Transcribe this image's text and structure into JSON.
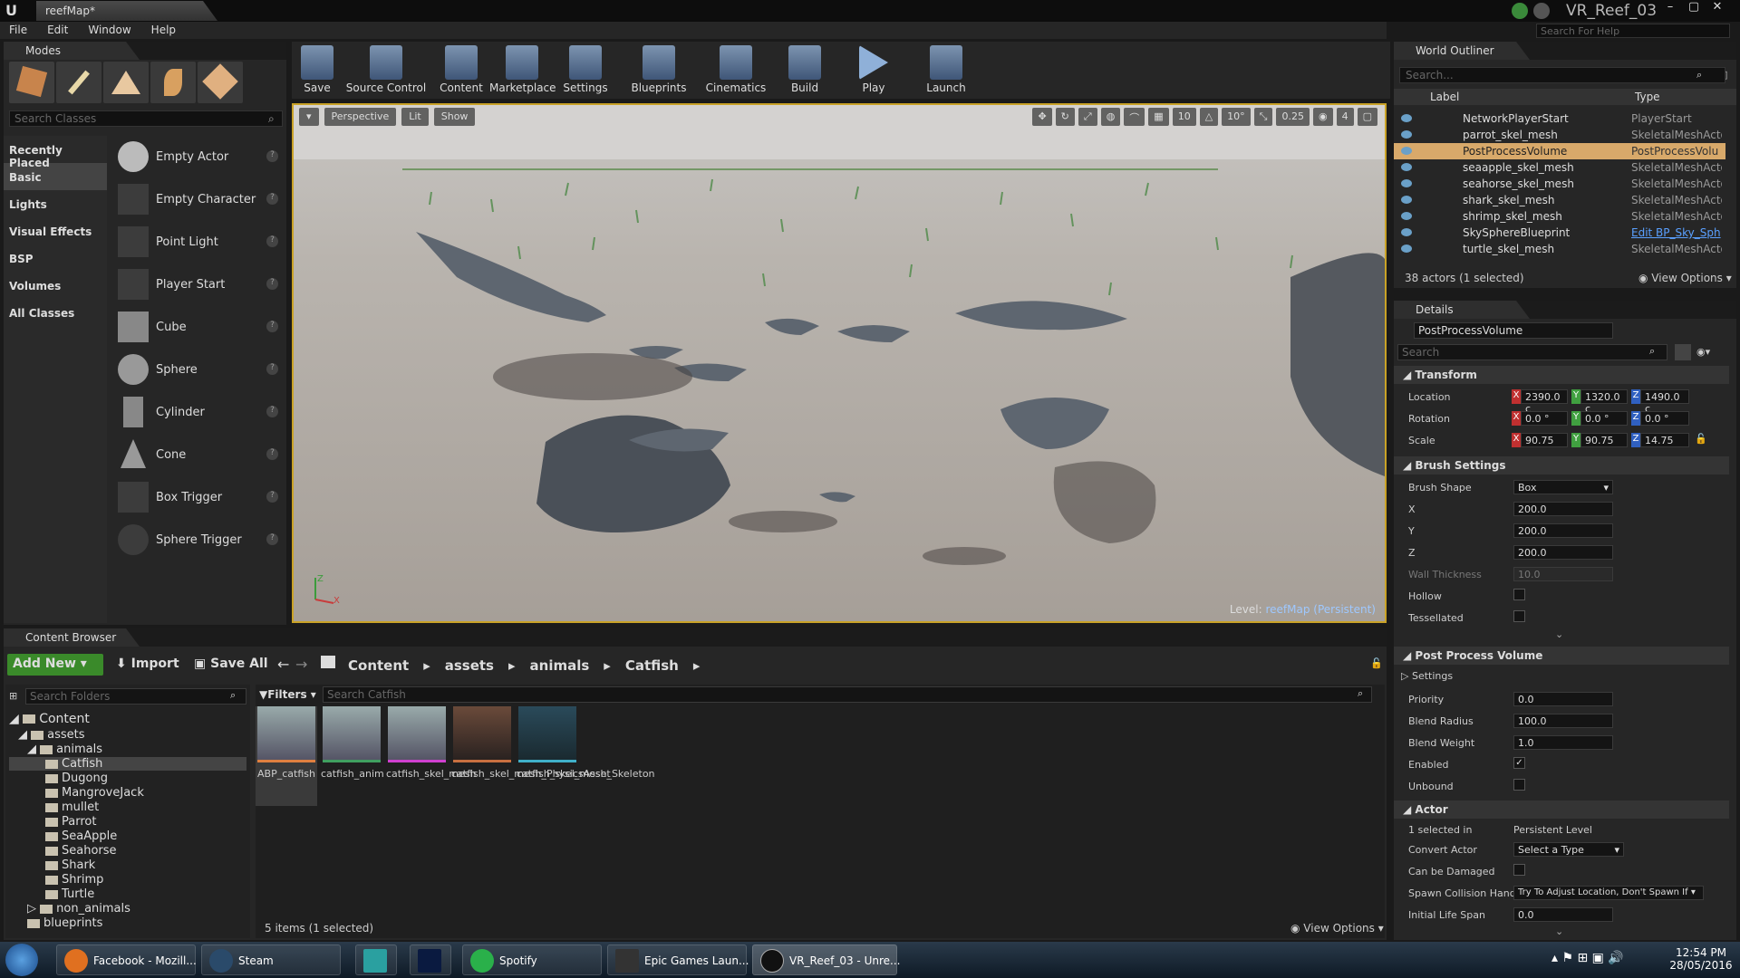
{
  "window": {
    "doc_tab": "reefMap*",
    "project": "VR_Reef_03",
    "help_placeholder": "Search For Help"
  },
  "menu": [
    "File",
    "Edit",
    "Window",
    "Help"
  ],
  "modes": {
    "tab": "Modes",
    "search_placeholder": "Search Classes",
    "categories": [
      "Recently Placed",
      "Basic",
      "Lights",
      "Visual Effects",
      "BSP",
      "Volumes",
      "All Classes"
    ],
    "items": [
      "Empty Actor",
      "Empty Character",
      "Point Light",
      "Player Start",
      "Cube",
      "Sphere",
      "Cylinder",
      "Cone",
      "Box Trigger",
      "Sphere Trigger"
    ]
  },
  "toolbar": [
    "Save",
    "Source Control",
    "Content",
    "Marketplace",
    "Settings",
    "Blueprints",
    "Cinematics",
    "Build",
    "Play",
    "Launch"
  ],
  "viewport": {
    "perspective": "Perspective",
    "lit": "Lit",
    "show": "Show",
    "grid_snap": "10",
    "rot_snap": "10°",
    "scale_snap": "0.25",
    "cam_speed": "4",
    "level_prefix": "Level:",
    "level_name": "reefMap (Persistent)"
  },
  "outliner": {
    "tab": "World Outliner",
    "search_placeholder": "Search...",
    "col_label": "Label",
    "col_type": "Type",
    "rows": [
      {
        "label": "NetworkPlayerStart",
        "type": "PlayerStart"
      },
      {
        "label": "parrot_skel_mesh",
        "type": "SkeletalMeshActo"
      },
      {
        "label": "PostProcessVolume",
        "type": "PostProcessVolu"
      },
      {
        "label": "seaapple_skel_mesh",
        "type": "SkeletalMeshActo"
      },
      {
        "label": "seahorse_skel_mesh",
        "type": "SkeletalMeshActo"
      },
      {
        "label": "shark_skel_mesh",
        "type": "SkeletalMeshActo"
      },
      {
        "label": "shrimp_skel_mesh",
        "type": "SkeletalMeshActo"
      },
      {
        "label": "SkySphereBlueprint",
        "type": "Edit BP_Sky_Sph"
      },
      {
        "label": "turtle_skel_mesh",
        "type": "SkeletalMeshActo"
      }
    ],
    "status": "38 actors (1 selected)",
    "view_options": "View Options"
  },
  "details": {
    "tab": "Details",
    "name": "PostProcessVolume",
    "search_placeholder": "Search",
    "transform": {
      "title": "Transform",
      "location": {
        "label": "Location",
        "x": "2390.0 c",
        "y": "1320.0 c",
        "z": "1490.0 c"
      },
      "rotation": {
        "label": "Rotation",
        "x": "0.0 °",
        "y": "0.0 °",
        "z": "0.0 °"
      },
      "scale": {
        "label": "Scale",
        "x": "90.75",
        "y": "90.75",
        "z": "14.75"
      }
    },
    "brush": {
      "title": "Brush Settings",
      "shape_label": "Brush Shape",
      "shape": "Box",
      "x_label": "X",
      "x": "200.0",
      "y_label": "Y",
      "y": "200.0",
      "z_label": "Z",
      "z": "200.0",
      "wall_label": "Wall Thickness",
      "wall": "10.0",
      "hollow": "Hollow",
      "tessellated": "Tessellated"
    },
    "ppv": {
      "title": "Post Process Volume",
      "settings": "Settings",
      "priority_label": "Priority",
      "priority": "0.0",
      "radius_label": "Blend Radius",
      "radius": "100.0",
      "weight_label": "Blend Weight",
      "weight": "1.0",
      "enabled": "Enabled",
      "unbound": "Unbound"
    },
    "actor": {
      "title": "Actor",
      "selected_label": "1 selected in",
      "selected_value": "Persistent Level",
      "convert_label": "Convert Actor",
      "convert_value": "Select a Type",
      "damage_label": "Can be Damaged",
      "spawn_label": "Spawn Collision Hand",
      "spawn_value": "Try To Adjust Location, Don't Spawn If",
      "life_label": "Initial Life Span",
      "life_value": "0.0"
    }
  },
  "content_browser": {
    "tab": "Content Browser",
    "add_new": "Add New",
    "import": "Import",
    "save_all": "Save All",
    "path": [
      "Content",
      "assets",
      "animals",
      "Catfish"
    ],
    "folder_search": "Search Folders",
    "filters": "Filters",
    "asset_search": "Search Catfish",
    "tree": {
      "root": "Content",
      "assets": "assets",
      "animals": "animals",
      "animal_folders": [
        "Catfish",
        "Dugong",
        "MangroveJack",
        "mullet",
        "Parrot",
        "SeaApple",
        "Seahorse",
        "Shark",
        "Shrimp",
        "Turtle"
      ],
      "non_animals": "non_animals",
      "blueprints": "blueprints"
    },
    "assets": [
      "ABP_catfish",
      "catfish_anim",
      "catfish_skel_mesh",
      "catfish_skel_mesh_PhysicsAsset",
      "catfish_skel_mesh_Skeleton"
    ],
    "status": "5 items (1 selected)",
    "view_options": "View Options"
  },
  "taskbar": {
    "apps": [
      "Facebook - Mozill...",
      "Steam",
      "Spotify",
      "Epic Games Laun...",
      "VR_Reef_03 - Unre..."
    ],
    "time": "12:54 PM",
    "date": "28/05/2016"
  }
}
